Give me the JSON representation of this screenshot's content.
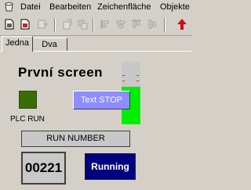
{
  "menu": {
    "items": [
      "Datei",
      "Bearbeiten",
      "Zeichenfläche",
      "Objekte"
    ]
  },
  "toolbar": {
    "icons": [
      "new-icon",
      "new-red-icon",
      "insert-icon",
      "copy-format-icon",
      "layer-icon",
      "align-left-icon",
      "align-center-icon",
      "align-top-icon",
      "align-middle-icon",
      "red-up-arrow-icon"
    ]
  },
  "tabs": [
    {
      "label": "Jedna",
      "active": true
    },
    {
      "label": "Dva",
      "active": false
    }
  ],
  "screen": {
    "title": "První screen",
    "plc_label": "PLC RUN",
    "plc_led_color": "#3b6d05",
    "text_stop_label": "Text STOP",
    "run_number_label": "RUN NUMBER",
    "counter_value": "00221",
    "running_label": "Running",
    "gauge_level": 0.6,
    "gauge_color": "#00ee00"
  }
}
